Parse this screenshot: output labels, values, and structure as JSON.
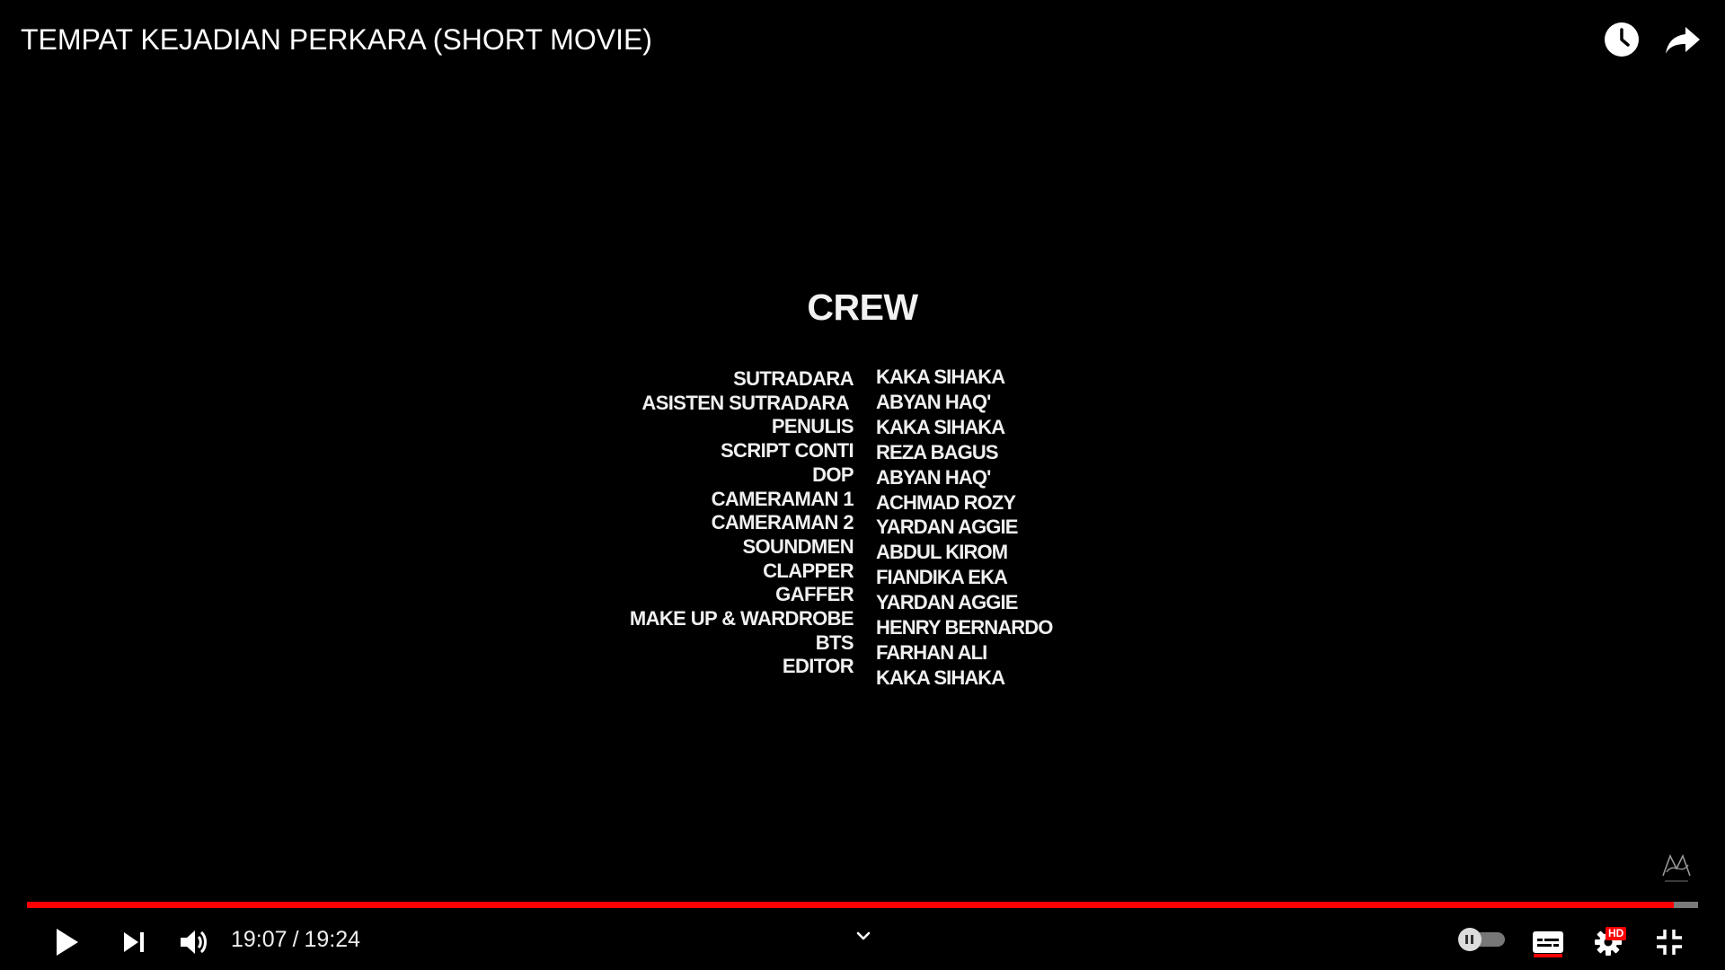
{
  "video": {
    "title": "TEMPAT KEJADIAN PERKARA (SHORT MOVIE)"
  },
  "top_actions": {
    "watch_later_icon": "clock-icon",
    "share_icon": "share-arrow-icon"
  },
  "credits": {
    "heading": "CREW",
    "roles": [
      "SUTRADARA",
      "ASISTEN SUTRADARA",
      "PENULIS",
      "SCRIPT CONTI",
      "DOP",
      "CAMERAMAN 1",
      "CAMERAMAN 2",
      "SOUNDMEN",
      "CLAPPER",
      "GAFFER",
      "MAKE UP & WARDROBE",
      "BTS",
      "EDITOR"
    ],
    "names": [
      "KAKA SIHAKA",
      "ABYAN HAQ'",
      "KAKA SIHAKA",
      "REZA BAGUS",
      "ABYAN HAQ'",
      "ACHMAD ROZY",
      "YARDAN AGGIE",
      "ABDUL KIROM",
      "FIANDIKA EKA",
      "YARDAN AGGIE",
      "HENRY BERNARDO",
      "FARHAN ALI",
      "KAKA SIHAKA"
    ]
  },
  "player": {
    "current_time": "19:07",
    "duration": "19:24",
    "progress_fraction": 0.9854,
    "hd_label": "HD",
    "autoplay_on": false,
    "subtitles_on": true,
    "colors": {
      "progress": "#ff0000",
      "track": "#7a7a7a",
      "background": "#000000"
    },
    "icons": {
      "play": "play-icon",
      "next": "next-icon",
      "volume": "volume-icon",
      "chevron": "chevron-down-icon",
      "subtitles": "subtitles-icon",
      "settings": "gear-icon",
      "exit_fullscreen": "exit-fullscreen-icon",
      "watermark": "channel-watermark-icon"
    }
  }
}
